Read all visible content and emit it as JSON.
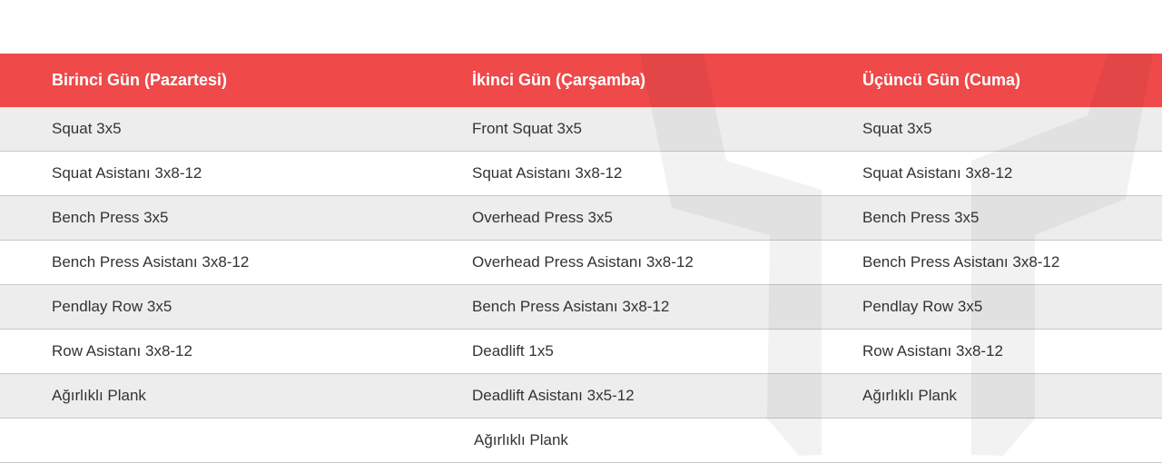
{
  "headers": [
    "Birinci Gün (Pazartesi)",
    "İkinci Gün (Çarşamba)",
    "Üçüncü Gün (Cuma)"
  ],
  "rows": [
    [
      "Squat 3x5",
      "Front Squat 3x5",
      "Squat 3x5"
    ],
    [
      "Squat Asistanı 3x8-12",
      "Squat Asistanı 3x8-12",
      "Squat Asistanı 3x8-12"
    ],
    [
      "Bench Press 3x5",
      "Overhead Press 3x5",
      "Bench Press 3x5"
    ],
    [
      "Bench Press Asistanı 3x8-12",
      "Overhead Press Asistanı 3x8-12",
      "Bench Press Asistanı 3x8-12"
    ],
    [
      "Pendlay Row 3x5",
      "Bench Press Asistanı 3x8-12",
      "Pendlay Row 3x5"
    ],
    [
      "Row Asistanı 3x8-12",
      "Deadlift 1x5",
      "Row Asistanı 3x8-12"
    ],
    [
      "Ağırlıklı Plank",
      "Deadlift Asistanı 3x5-12",
      "Ağırlıklı Plank"
    ],
    [
      "",
      "Ağırlıklı Plank",
      ""
    ]
  ],
  "colors": {
    "header_bg": "#ef4949",
    "header_text": "#ffffff",
    "row_alt_bg": "#ededed",
    "row_bg": "#ffffff",
    "divider": "#c8c8c8"
  },
  "watermark_icon": "brand-logo-watermark"
}
